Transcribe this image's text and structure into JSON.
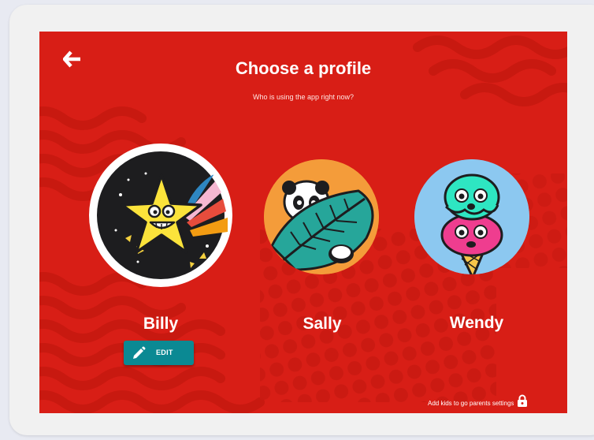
{
  "header": {
    "title": "Choose a profile",
    "subtitle": "Who is using the app right now?"
  },
  "profiles": [
    {
      "name": "Billy",
      "avatar": "star-avatar",
      "selected": true
    },
    {
      "name": "Sally",
      "avatar": "panda-avatar",
      "selected": false
    },
    {
      "name": "Wendy",
      "avatar": "ice-cream-avatar",
      "selected": false
    }
  ],
  "edit_button": {
    "label": "EDIT",
    "icon": "pencil-icon"
  },
  "parent_settings": {
    "label": "Add kids to go parents settings",
    "icon": "lock-icon"
  },
  "colors": {
    "background": "#d81e16",
    "edit_button": "#0b8993",
    "text": "#ffffff"
  }
}
